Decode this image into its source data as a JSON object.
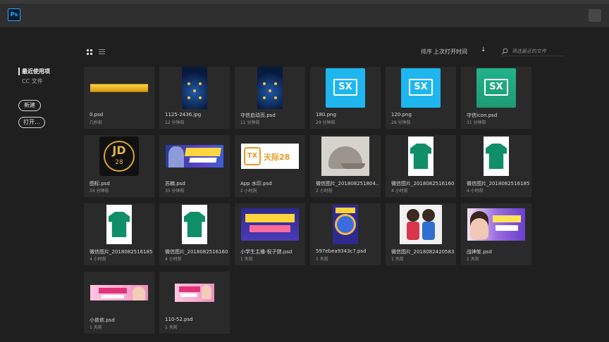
{
  "app": {
    "logo": "Ps"
  },
  "sidebar": {
    "recent": "最近使用项",
    "cc_files": "CC 文件",
    "new_button": "新建",
    "open_button": "打开..."
  },
  "toolbar": {
    "sort_label": "排序",
    "sort_value": "上次打开时间",
    "search_placeholder": "筛选最近的文件"
  },
  "files": [
    {
      "name": "0.psd",
      "time": "几秒前",
      "thumb": "gold-bar"
    },
    {
      "name": "1125-2436.jpg",
      "time": "12 分钟前",
      "thumb": "phone-splash"
    },
    {
      "name": "守信启动页.psd",
      "time": "11 分钟前",
      "thumb": "phone-splash"
    },
    {
      "name": "180.png",
      "time": "29 分钟前",
      "thumb": "sx-logo-light"
    },
    {
      "name": "120.png",
      "time": "29 分钟前",
      "thumb": "sx-logo-light"
    },
    {
      "name": "守信icon.psd",
      "time": "31 分钟前",
      "thumb": "sx-logo-dark"
    },
    {
      "name": "图标.psd",
      "time": "34 分钟前",
      "thumb": "jd28-logo"
    },
    {
      "name": "苏楠.psd",
      "time": "35 分钟前",
      "thumb": "game-banner"
    },
    {
      "name": "App 水印.psd",
      "time": "2 小时前",
      "thumb": "tianxia-logo"
    },
    {
      "name": "微信图片_201808251804...",
      "time": "2 小时前",
      "thumb": "cap-photo"
    },
    {
      "name": "微信图片_2018082516160...",
      "time": "4 小时前",
      "thumb": "green-shirt"
    },
    {
      "name": "微信图片_2018082516185...",
      "time": "4 小时前",
      "thumb": "green-shirt"
    },
    {
      "name": "微信图片_2018082516185...",
      "time": "4 小时前",
      "thumb": "green-shirt"
    },
    {
      "name": "微信图片_2018082516160...",
      "time": "4 小时前",
      "thumb": "green-shirt"
    },
    {
      "name": "小学生主播-祝子健.psd",
      "time": "1 天前",
      "thumb": "student-banner"
    },
    {
      "name": "597ebea9343c7.psd",
      "time": "1 天前",
      "thumb": "space-poster"
    },
    {
      "name": "微信图片_2018082420583...",
      "time": "1 天前",
      "thumb": "kids-photo"
    },
    {
      "name": "战神笙.psd",
      "time": "1 天前",
      "thumb": "girl-banner"
    },
    {
      "name": "小依依.psd",
      "time": "1 天前",
      "thumb": "pink-banner"
    },
    {
      "name": "110-52.psd",
      "time": "1 天前",
      "thumb": "pink-banner-small"
    }
  ],
  "thumb_text": {
    "jd_letters": "JD",
    "jd_number": "28",
    "tx_letters": "TX",
    "tx_name": "天际28",
    "sx_text": "SX"
  },
  "colors": {
    "accent": "#31a8ff",
    "background": "#1f1f1f",
    "card": "#2a2a2a",
    "sx_light": "#1fb6f0",
    "sx_dark": "#1e9a74"
  }
}
